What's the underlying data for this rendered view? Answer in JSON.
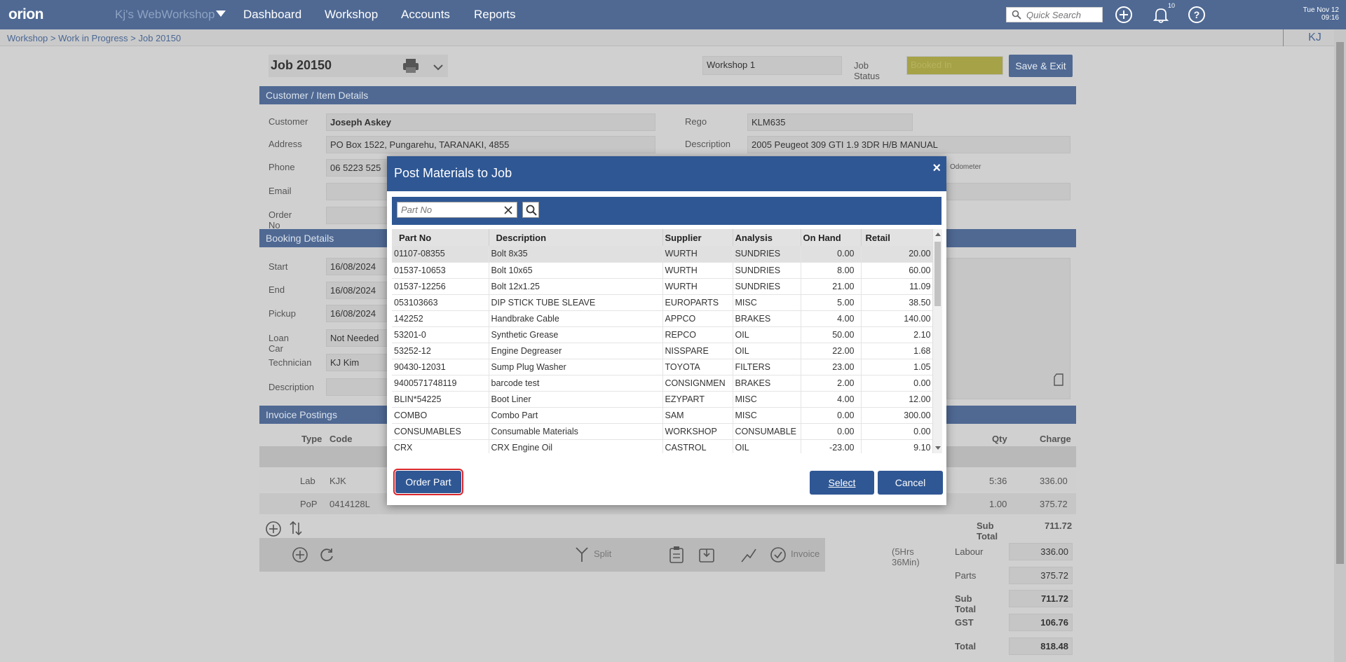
{
  "nav": {
    "logo": "orion",
    "site_name": "Kj's WebWorkshop",
    "items": [
      "Dashboard",
      "Workshop",
      "Accounts",
      "Reports"
    ],
    "quick_search_placeholder": "Quick Search",
    "notification_count": "10",
    "date": "Tue Nov 12",
    "time": "09:16"
  },
  "breadcrumb": "Workshop > Work in Progress > Job 20150",
  "user_initials": "KJ",
  "job": {
    "title": "Job 20150",
    "workshop_select": "Workshop 1",
    "job_status_label": "Job Status",
    "job_status_value": "Booked In",
    "save_exit": "Save & Exit"
  },
  "customer_section": {
    "header": "Customer / Item Details",
    "customer_label": "Customer",
    "customer_value": "Joseph Askey",
    "address_label": "Address",
    "address_value": "PO Box 1522, Pungarehu, TARANAKI, 4855",
    "phone_label": "Phone",
    "phone_value": "06 5223 525",
    "email_label": "Email",
    "order_label": "Order No",
    "rego_label": "Rego",
    "rego_value": "KLM635",
    "description_label": "Description",
    "description_value": "2005 Peugeot 309 GTI 1.9 3DR H/B MANUAL",
    "odometer_text": "Odometer"
  },
  "booking_section": {
    "header": "Booking Details",
    "start_label": "Start",
    "start_value": "16/08/2024",
    "end_label": "End",
    "end_value": "16/08/2024",
    "pickup_label": "Pickup",
    "pickup_value": "16/08/2024",
    "loan_label": "Loan Car",
    "loan_value": "Not Needed",
    "tech_label": "Technician",
    "tech_value": "KJ Kim",
    "desc_label": "Description"
  },
  "invoice_section": {
    "header": "Invoice Postings",
    "col_type": "Type",
    "col_code": "Code",
    "col_qty": "Qty",
    "col_charge": "Charge",
    "rows": [
      {
        "type": "Lab",
        "code": "KJK",
        "qty": "5:36",
        "charge": "336.00"
      },
      {
        "type": "PoP",
        "code": "0414128L",
        "qty": "1.00",
        "charge": "375.72"
      }
    ],
    "subtotal_label": "Sub Total",
    "subtotal_value": "711.72",
    "hours_text": "(5Hrs 36Min)",
    "split_label": "Split",
    "invoice_label": "Invoice",
    "totals": [
      {
        "label": "Labour",
        "value": "336.00"
      },
      {
        "label": "Parts",
        "value": "375.72"
      },
      {
        "label": "Sub Total",
        "value": "711.72"
      },
      {
        "label": "GST",
        "value": "106.76"
      },
      {
        "label": "Total",
        "value": "818.48"
      }
    ]
  },
  "modal": {
    "title": "Post Materials to Job",
    "close": "×",
    "search_placeholder": "Part No",
    "columns": [
      "Part No",
      "Description",
      "Supplier",
      "Analysis",
      "On Hand",
      "Retail"
    ],
    "rows": [
      [
        "01107-08355",
        "Bolt 8x35",
        "WURTH",
        "SUNDRIES",
        "0.00",
        "20.00"
      ],
      [
        "01537-10653",
        "Bolt 10x65",
        "WURTH",
        "SUNDRIES",
        "8.00",
        "60.00"
      ],
      [
        "01537-12256",
        "Bolt 12x1.25",
        "WURTH",
        "SUNDRIES",
        "21.00",
        "11.09"
      ],
      [
        "053103663",
        "DIP STICK TUBE SLEAVE",
        "EUROPARTS",
        "MISC",
        "5.00",
        "38.50"
      ],
      [
        "142252",
        "Handbrake Cable",
        "APPCO",
        "BRAKES",
        "4.00",
        "140.00"
      ],
      [
        "53201-0",
        "Synthetic Grease",
        "REPCO",
        "OIL",
        "50.00",
        "2.10"
      ],
      [
        "53252-12",
        "Engine Degreaser",
        "NISSPARE",
        "OIL",
        "22.00",
        "1.68"
      ],
      [
        "90430-12031",
        "Sump Plug Washer",
        "TOYOTA",
        "FILTERS",
        "23.00",
        "1.05"
      ],
      [
        "9400571748119",
        "barcode test",
        "CONSIGNMEN",
        "BRAKES",
        "2.00",
        "0.00"
      ],
      [
        "BLIN*54225",
        "Boot Liner",
        "EZYPART",
        "MISC",
        "4.00",
        "12.00"
      ],
      [
        "COMBO",
        "Combo Part",
        "SAM",
        "MISC",
        "0.00",
        "300.00"
      ],
      [
        "CONSUMABLES",
        "Consumable Materials",
        "WORKSHOP",
        "CONSUMABLE",
        "0.00",
        "0.00"
      ],
      [
        "CRX",
        "CRX Engine Oil",
        "CASTROL",
        "OIL",
        "-23.00",
        "9.10"
      ]
    ],
    "order_part": "Order Part",
    "select": "Select",
    "cancel": "Cancel"
  }
}
